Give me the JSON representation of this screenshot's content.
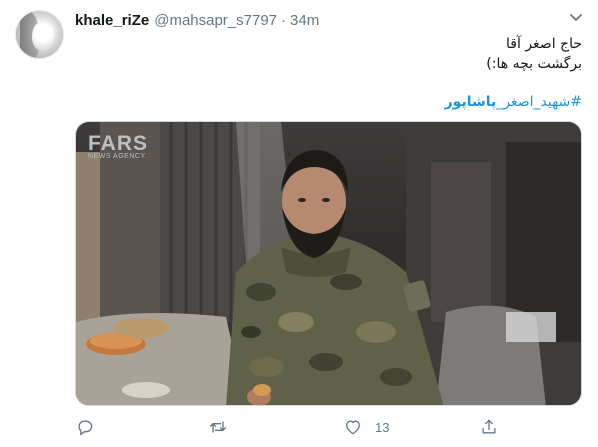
{
  "tweet": {
    "display_name": "khale_riZe",
    "handle": "@mahsapr_s7797",
    "separator": "·",
    "time": "34m",
    "text_lines": [
      "حاج اصغر آقا",
      "برگشت بچه ها:)"
    ],
    "hashtag_prefix": "#شهید_اصغر_",
    "hashtag_bold": "پاشاپور",
    "media_watermark_big": "FARS",
    "media_watermark_small": "NEWS AGENCY"
  },
  "actions": {
    "reply_icon": "reply-icon",
    "retweet_icon": "retweet-icon",
    "like_icon": "heart-icon",
    "like_count": "13",
    "share_icon": "share-icon"
  },
  "colors": {
    "link": "#1b95e0",
    "secondary": "#657786",
    "primary_text": "#14171a"
  }
}
